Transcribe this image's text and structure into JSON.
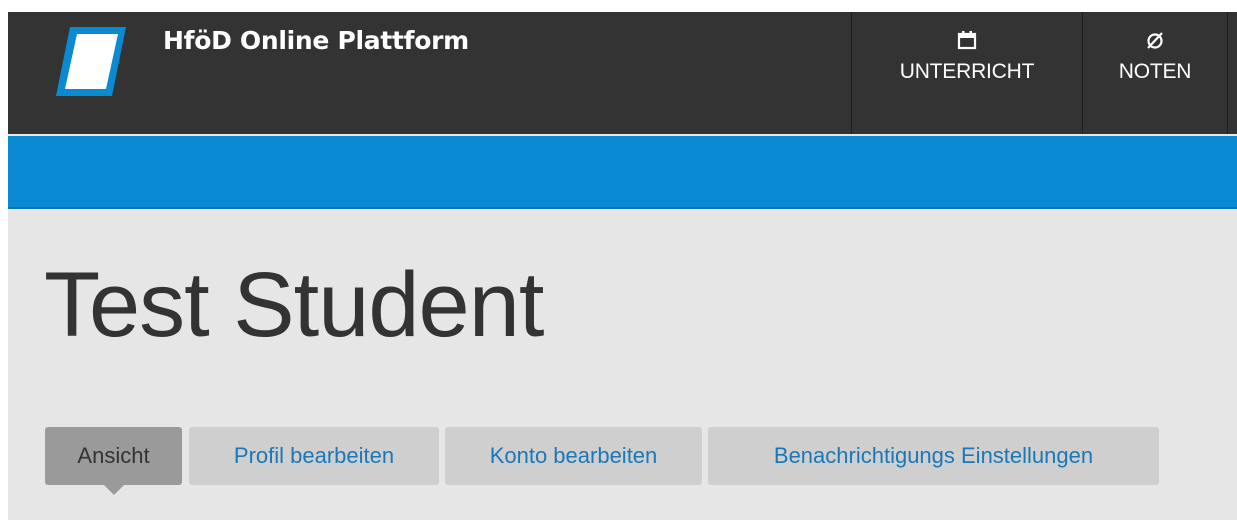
{
  "header": {
    "site_name": "HföD Online Plattform",
    "nav": [
      {
        "label": "UNTERRICHT",
        "icon": "calendar-icon"
      },
      {
        "label": "NOTEN",
        "icon": "grades-icon"
      }
    ]
  },
  "profile": {
    "name": "Test Student"
  },
  "tabs": [
    {
      "label": "Ansicht",
      "active": true
    },
    {
      "label": "Profil bearbeiten",
      "active": false
    },
    {
      "label": "Konto bearbeiten",
      "active": false
    },
    {
      "label": "Benachrichtigungs Einstellungen",
      "active": false
    }
  ],
  "colors": {
    "header_bg": "#333333",
    "brand_blue": "#0a8ad1",
    "page_bg": "#e6e6e6",
    "tab_bg": "#cfcfcf",
    "tab_active_bg": "#9a9a9a",
    "link": "#1a78b8"
  }
}
